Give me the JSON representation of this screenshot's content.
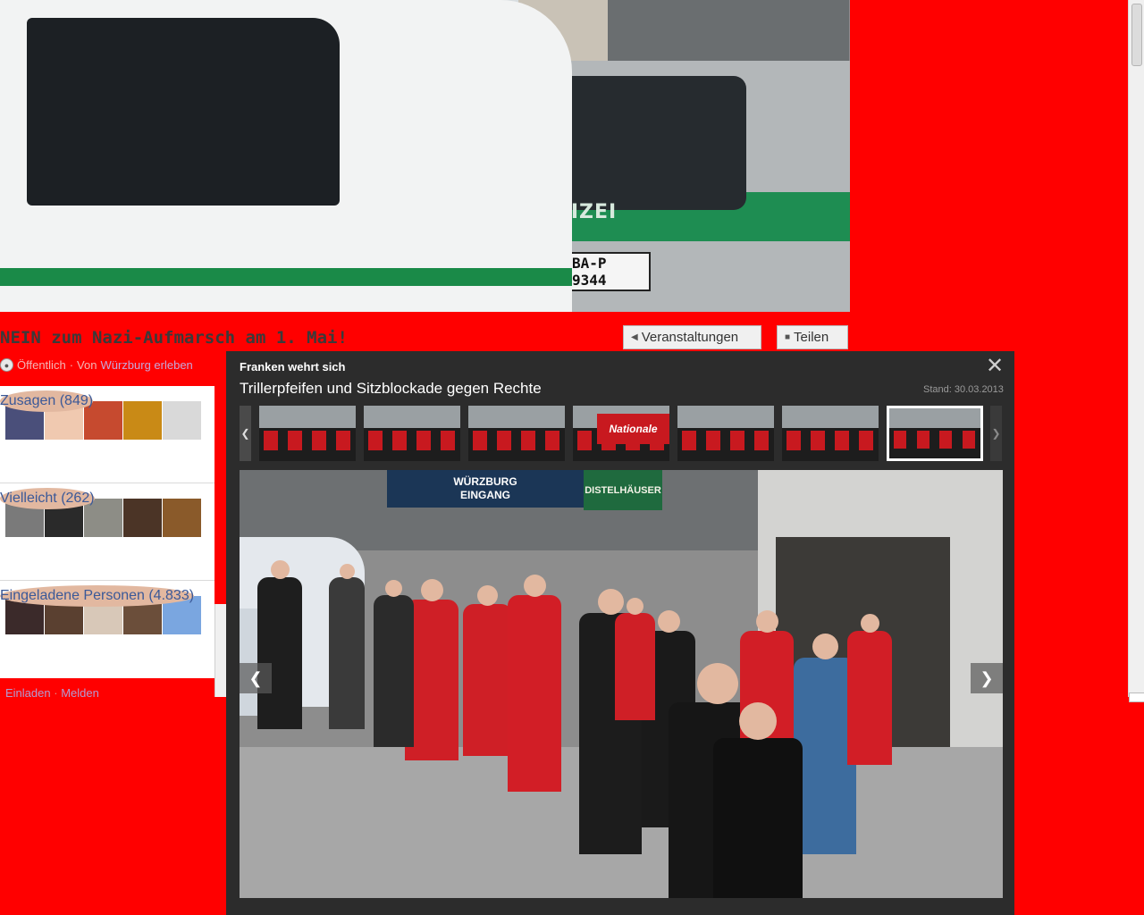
{
  "cover": {
    "plate": "BA-P 9344",
    "van_label": "POLIZEI"
  },
  "event": {
    "title": "NEIN zum Nazi-Aufmarsch am 1. Mai!",
    "privacy": "Öffentlich",
    "separator": "·",
    "by_prefix": "Von",
    "by_name": "Würzburg erleben"
  },
  "toolbar": {
    "events_label": "Veranstaltungen",
    "share_label": "Teilen"
  },
  "guests": {
    "going": {
      "label": "Zusagen (849)"
    },
    "maybe": {
      "label": "Vielleicht (262)"
    },
    "invited": {
      "label": "Eingeladene Personen (4.833)"
    },
    "avatar_colors": {
      "going": [
        "#4a4f7a",
        "#f0c9b0",
        "#c64a2f",
        "#c98a16",
        "#d9d9d9"
      ],
      "maybe": [
        "#7a7a7a",
        "#2a2a2a",
        "#8d8d86",
        "#4b3426",
        "#8a5a2a"
      ],
      "invited": [
        "#3b2a2a",
        "#5a4030",
        "#d8c8b8",
        "#6b4e3a",
        "#7aa6e0"
      ]
    }
  },
  "invite": {
    "invite_link": "Einladen",
    "separator": "·",
    "report_link": "Melden"
  },
  "lightbox": {
    "source": "Franken wehrt sich",
    "title": "Trillerpfeifen und Sitzblockade gegen Rechte",
    "date": "Stand: 30.03.2013",
    "thumbs": [
      {
        "label": ""
      },
      {
        "label": ""
      },
      {
        "label": ""
      },
      {
        "label": "Nationale"
      },
      {
        "label": ""
      },
      {
        "label": ""
      },
      {
        "label": ""
      }
    ],
    "photo": {
      "sign_top": "WÜRZBURG",
      "sign_bottom": "EINGANG",
      "sign_brewery": "DISTELHÄUSER"
    }
  }
}
